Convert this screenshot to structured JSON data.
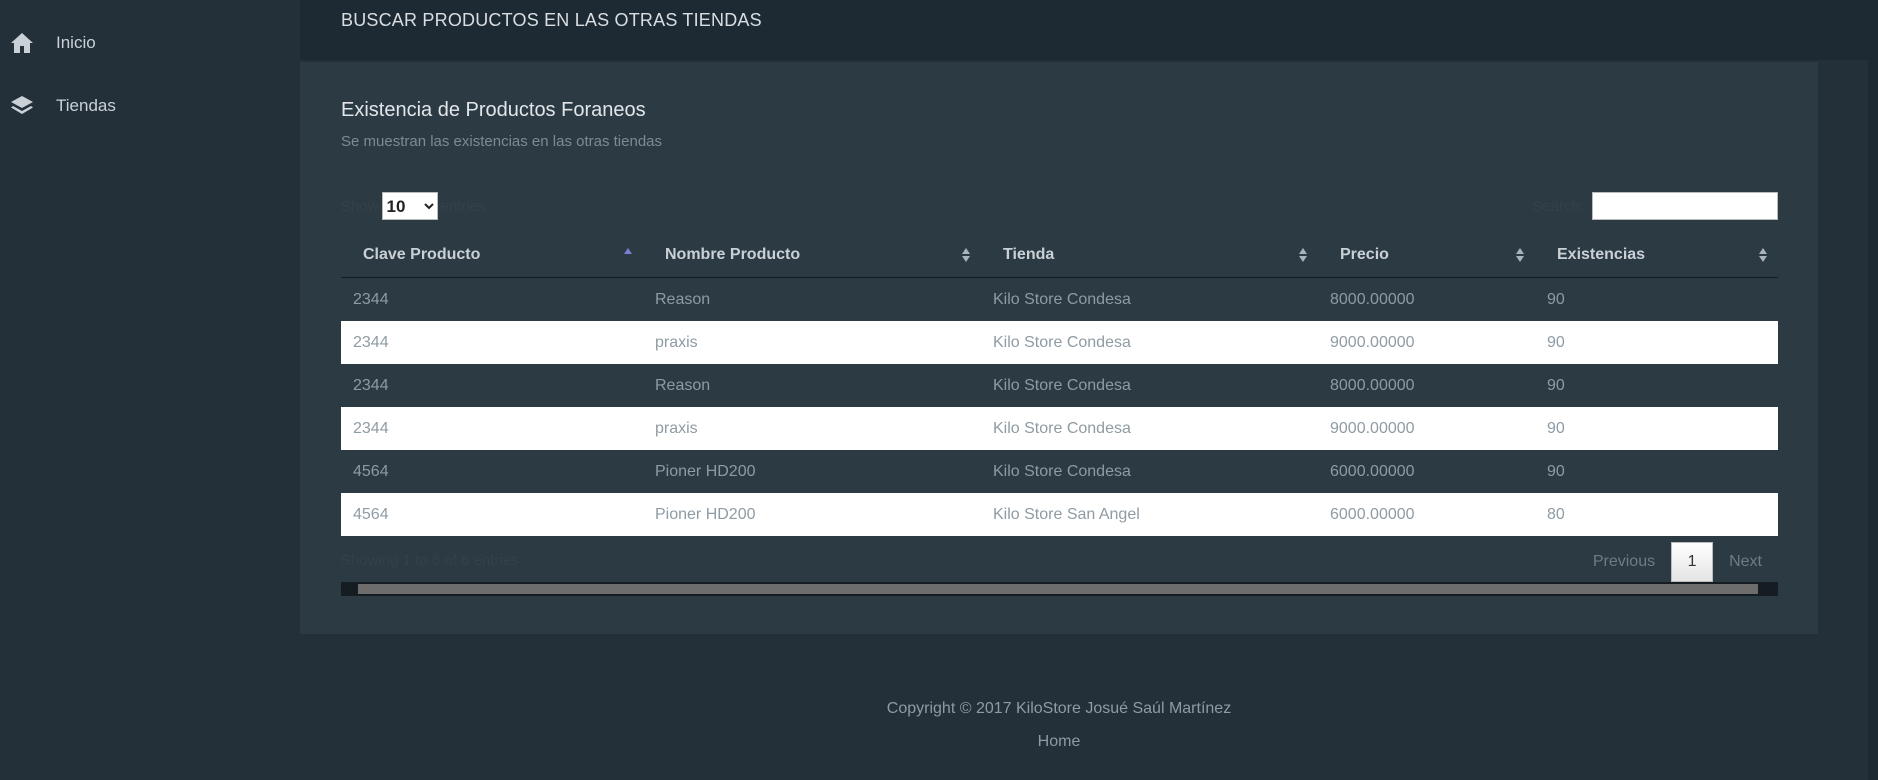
{
  "sidebar": {
    "items": [
      {
        "label": "Inicio",
        "icon": "home-icon"
      },
      {
        "label": "Tiendas",
        "icon": "layers-icon"
      }
    ]
  },
  "header": {
    "title": "BUSCAR PRODUCTOS EN LAS OTRAS TIENDAS"
  },
  "panel": {
    "title": "Existencia de Productos Foraneos",
    "subtitle": "Se muestran las existencias en las otras tiendas",
    "length": {
      "prefix": "Show",
      "value": "10",
      "suffix": "entries"
    },
    "search": {
      "label": "Search:"
    },
    "columns": [
      "Clave Producto",
      "Nombre Producto",
      "Tienda",
      "Precio",
      "Existencias"
    ],
    "rows": [
      [
        "2344",
        "Reason",
        "Kilo Store Condesa",
        "8000.00000",
        "90"
      ],
      [
        "2344",
        "praxis",
        "Kilo Store Condesa",
        "9000.00000",
        "90"
      ],
      [
        "2344",
        "Reason",
        "Kilo Store Condesa",
        "8000.00000",
        "90"
      ],
      [
        "2344",
        "praxis",
        "Kilo Store Condesa",
        "9000.00000",
        "90"
      ],
      [
        "4564",
        "Pioner HD200",
        "Kilo Store Condesa",
        "6000.00000",
        "90"
      ],
      [
        "4564",
        "Pioner HD200",
        "Kilo Store San Angel",
        "6000.00000",
        "80"
      ]
    ],
    "info": "Showing 1 to 6 of 6 entries",
    "pagination": {
      "previous": "Previous",
      "current": "1",
      "next": "Next"
    }
  },
  "footer": {
    "copyright": "Copyright © 2017 KiloStore Josué Saúl Martínez",
    "home": "Home"
  },
  "colors": {
    "background": "#23303a",
    "panel": "#2c3a44",
    "topbar": "#1e2a33",
    "sort_active": "#7b7fd4"
  }
}
